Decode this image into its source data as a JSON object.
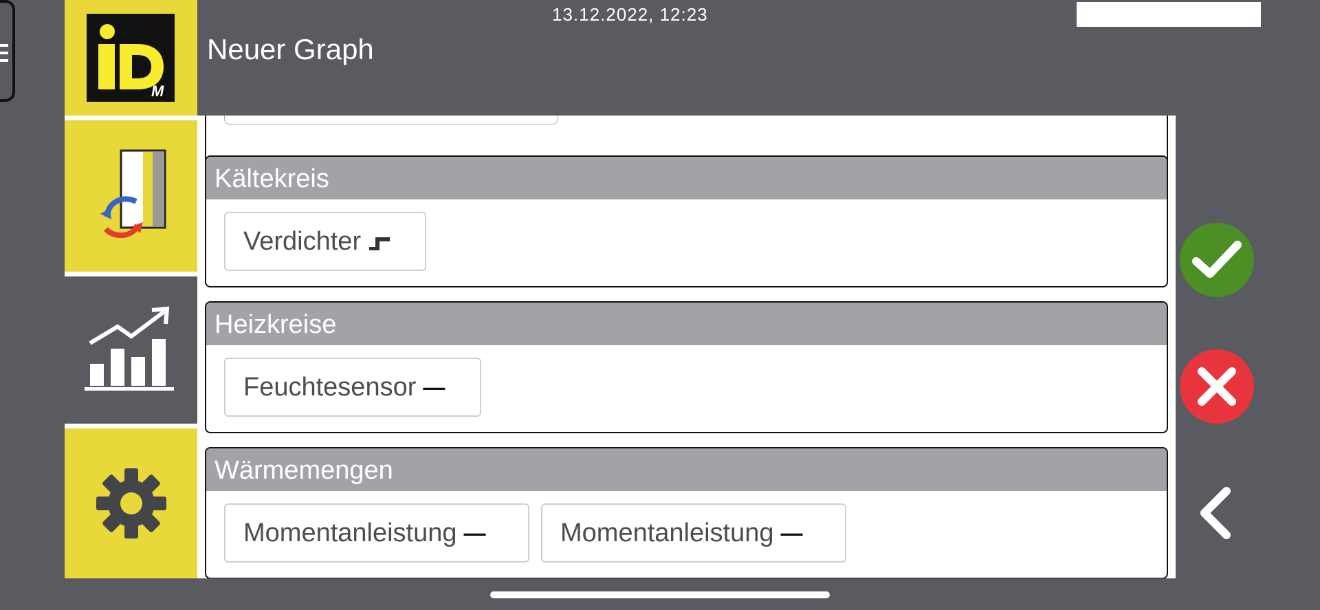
{
  "header": {
    "datetime": "13.12.2022, 12:23",
    "title": "Neuer Graph"
  },
  "logo": {
    "text": "iD",
    "sub": "M",
    "colors": {
      "background": "#111111",
      "letters": "#f7ec2e"
    }
  },
  "sidebar": {
    "items": [
      {
        "name": "heat-pump",
        "icon": "heat-pump-icon"
      },
      {
        "name": "graph",
        "icon": "chart-trend-icon",
        "active": true
      },
      {
        "name": "settings",
        "icon": "gear-icon"
      }
    ]
  },
  "sections": [
    {
      "title": "Kältekreis",
      "items": [
        {
          "label": "Verdichter",
          "symbol": "▗▀"
        }
      ]
    },
    {
      "title": "Heizkreise",
      "items": [
        {
          "label": "Feuchtesensor",
          "symbol": "—"
        }
      ]
    },
    {
      "title": "Wärmemengen",
      "items": [
        {
          "label": "Momentanleistung",
          "symbol": "—"
        },
        {
          "label": "Momentanleistung",
          "symbol": "—"
        }
      ]
    }
  ],
  "actions": {
    "confirm_icon": "check-icon",
    "cancel_icon": "close-icon",
    "back_icon": "chevron-left-icon"
  },
  "colors": {
    "yellow": "#e8d83a",
    "background": "#5a5b60",
    "confirm": "#4c8f25",
    "cancel": "#e8343c",
    "section_header": "#a2a3a7"
  }
}
